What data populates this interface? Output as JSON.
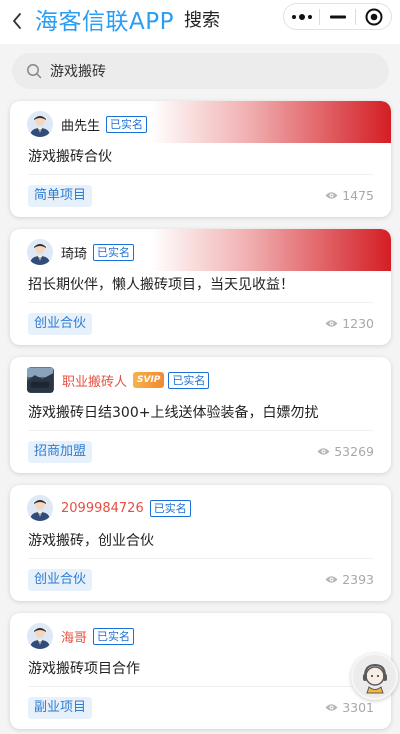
{
  "header": {
    "back_icon": "chevron-left-icon",
    "brand": "海客信联APP",
    "title": "搜索",
    "capsule": {
      "more_icon": "more-dots-icon",
      "minimize_icon": "minimize-icon",
      "close_icon": "target-close-icon"
    }
  },
  "search": {
    "icon": "search-icon",
    "value": "游戏搬砖"
  },
  "colors": {
    "brand": "#2a9df4",
    "stripe": "#d31e24",
    "verified": "#1b6fd6",
    "tag_bg": "#e6f1fc",
    "tag_text": "#2f7ccf",
    "username_red": "#e55040"
  },
  "posts": [
    {
      "username": "曲先生",
      "verified": "已实名",
      "title": "游戏搬砖合伙",
      "tag": "简单项目",
      "views": "1475"
    },
    {
      "username": "琦琦",
      "verified": "已实名",
      "title": "招长期伙伴，懒人搬砖项目，当天见收益！",
      "tag": "创业合伙",
      "views": "1230"
    },
    {
      "username": "职业搬砖人",
      "badge": "SVIP",
      "verified": "已实名",
      "title": "游戏搬砖日结300+上线送体验装备，白嫖勿扰",
      "tag": "招商加盟",
      "views": "53269"
    },
    {
      "username": "2099984726",
      "verified": "已实名",
      "title": "游戏搬砖，创业合伙",
      "tag": "创业合伙",
      "views": "2393"
    },
    {
      "username": "海哥",
      "verified": "已实名",
      "title": "游戏搬砖项目合作",
      "tag": "副业项目",
      "views": "3301"
    }
  ],
  "fab": {
    "icon": "customer-service-icon"
  }
}
